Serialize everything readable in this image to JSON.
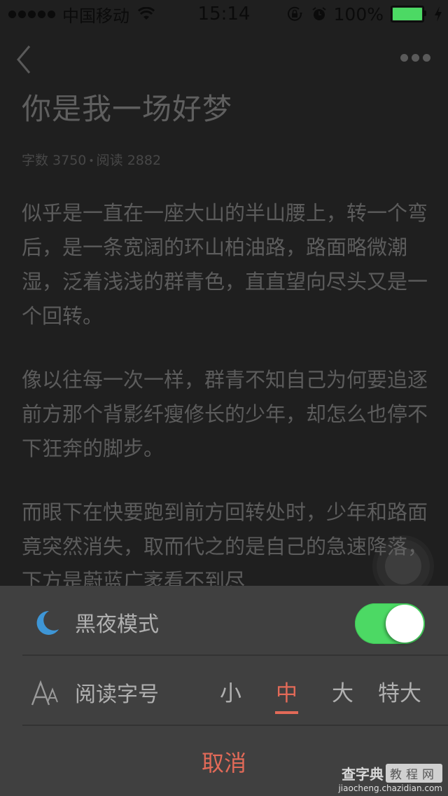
{
  "status_bar": {
    "carrier": "中国移动",
    "time": "15:14",
    "battery_percent": "100%",
    "battery_fill": 1.0,
    "icons": [
      "signal-dots-icon",
      "wifi-icon",
      "rotation-lock-icon",
      "alarm-icon",
      "battery-icon",
      "charging-bolt-icon"
    ]
  },
  "nav": {
    "back_icon": "chevron-left-icon",
    "more_icon": "more-dots-icon"
  },
  "article": {
    "title": "你是我一场好梦",
    "word_count_label": "字数 3750",
    "separator": "•",
    "read_count_label": "阅读 2882",
    "paragraphs": [
      "似乎是一直在一座大山的半山腰上，转一个弯后，是一条宽阔的环山柏油路，路面略微潮湿，泛着浅浅的群青色，直直望向尽头又是一个回转。",
      "像以往每一次一样，群青不知自己为何要追逐前方那个背影纤瘦修长的少年，却怎么也停不下狂奔的脚步。",
      "而眼下在快要跑到前方回转处时，少年和路面竟突然消失，取而代之的是自己的急速降落，下方是蔚蓝广袤看不到尽"
    ]
  },
  "settings_sheet": {
    "night_mode": {
      "icon": "moon-icon",
      "label": "黑夜模式",
      "enabled": true,
      "accent": "#4cd964"
    },
    "font_size": {
      "icon": "font-size-icon",
      "label": "阅读字号",
      "options": [
        "小",
        "中",
        "大",
        "特大"
      ],
      "selected": "中",
      "accent": "#e26a58"
    },
    "cancel_label": "取消"
  },
  "watermark": {
    "brand": "查字典",
    "box": "教程网",
    "url": "jiaocheng.chazidian.com"
  }
}
